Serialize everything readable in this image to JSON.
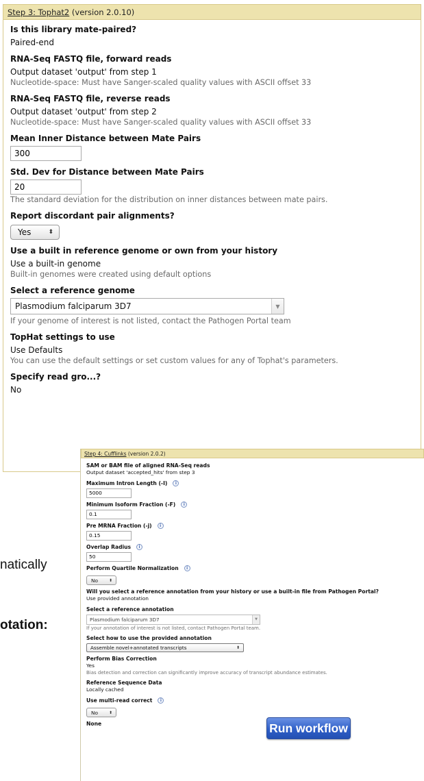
{
  "tophat": {
    "step_link": "Step 3: Tophat2",
    "version": "(version 2.0.10)",
    "mate_paired": {
      "label": "Is this library mate-paired?",
      "value": "Paired-end"
    },
    "forward_reads": {
      "label": "RNA-Seq FASTQ file, forward reads",
      "value": "Output dataset 'output' from step 1",
      "help": "Nucleotide-space: Must have Sanger-scaled quality values with ASCII offset 33"
    },
    "reverse_reads": {
      "label": "RNA-Seq FASTQ file, reverse reads",
      "value": "Output dataset 'output' from step 2",
      "help": "Nucleotide-space: Must have Sanger-scaled quality values with ASCII offset 33"
    },
    "mean_inner_distance": {
      "label": "Mean Inner Distance between Mate Pairs",
      "value": "300"
    },
    "std_dev": {
      "label": "Std. Dev for Distance between Mate Pairs",
      "value": "20",
      "help": "The standard deviation for the distribution on inner distances between mate pairs."
    },
    "discordant": {
      "label": "Report discordant pair alignments?",
      "value": "Yes"
    },
    "builtin_ref": {
      "label": "Use a built in reference genome or own from your history",
      "value": "Use a built-in genome",
      "help": "Built-in genomes were created using default options"
    },
    "ref_genome": {
      "label": "Select a reference genome",
      "value": "Plasmodium falciparum 3D7",
      "help": "If your genome of interest is not listed, contact the Pathogen Portal team"
    },
    "settings": {
      "label": "TopHat settings to use",
      "value": "Use Defaults",
      "help": "You can use the default settings or set custom values for any of Tophat's parameters."
    },
    "read_group": {
      "label": "Specify read gro...?",
      "value": "No"
    }
  },
  "slide": {
    "text1": "natically",
    "text2": "otation:"
  },
  "cufflinks": {
    "step_link": "Step 4: Cufflinks",
    "version": "(version 2.0.2)",
    "sam_bam": {
      "label": "SAM or BAM file of aligned RNA-Seq reads",
      "value": "Output dataset 'accepted_hits' from step 3"
    },
    "max_intron": {
      "label": "Maximum Intron Length (-I)",
      "value": "5000"
    },
    "min_isoform": {
      "label": "Minimum Isoform Fraction (-F)",
      "value": "0.1"
    },
    "pre_mrna": {
      "label": "Pre MRNA Fraction (-j)",
      "value": "0.15"
    },
    "overlap_radius": {
      "label": "Overlap Radius",
      "value": "50"
    },
    "quartile": {
      "label": "Perform Quartile Normalization",
      "value": "No"
    },
    "ref_annotation_choice": {
      "label": "Will you select a reference annotation from your history or use a built-in file from Pathogen Portal?",
      "value": "Use provided annotation"
    },
    "ref_annotation": {
      "label": "Select a reference annotation",
      "value": "Plasmodium falciparum 3D7",
      "help": "If your annotation of interest is not listed, contact Pathogen Portal team."
    },
    "use_annotation": {
      "label": "Select how to use the provided annotation",
      "value": "Assemble novel+annotated transcripts"
    },
    "bias_correction": {
      "label": "Perform Bias Correction",
      "value": "Yes",
      "help": "Bias detection and correction can significantly improve accuracy of transcript abundance estimates."
    },
    "ref_seq": {
      "label": "Reference Sequence Data",
      "value": "Locally cached"
    },
    "multi_read": {
      "label": "Use multi-read correct",
      "value": "No"
    },
    "last_value": "None"
  },
  "run_button": {
    "label": "Run workflow"
  },
  "icons": {
    "info": "i",
    "updown": "⬍",
    "dropdown": "▼"
  },
  "colors": {
    "header_bg": "#ede3ae",
    "run_button": "#2f5fc8",
    "help_text": "#6a6a6a"
  }
}
